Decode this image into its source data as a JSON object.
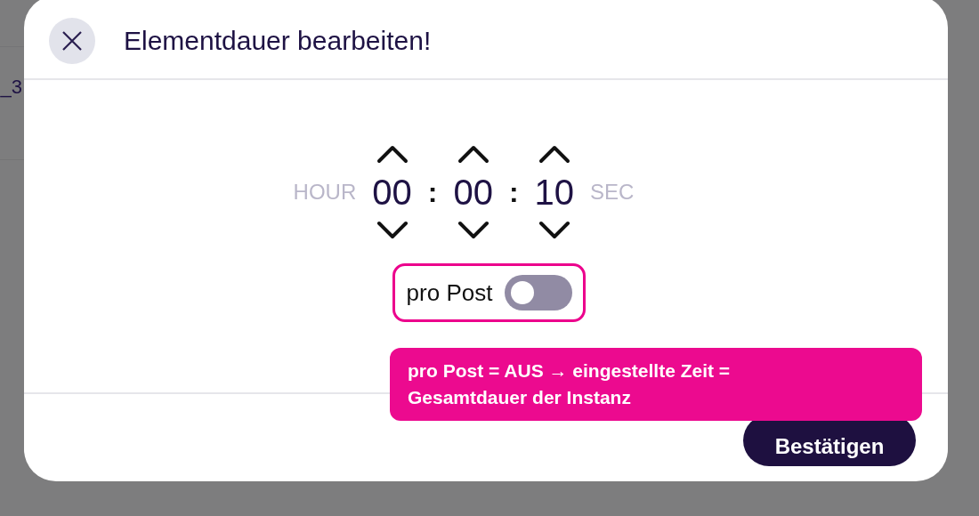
{
  "backdrop": {
    "text": "_3"
  },
  "dialog": {
    "title": "Elementdauer bearbeiten!",
    "time": {
      "leading_label": "HOUR",
      "trailing_label": "SEC",
      "separators": [
        ":",
        ":"
      ],
      "fields": [
        {
          "value": "00"
        },
        {
          "value": "00"
        },
        {
          "value": "10"
        }
      ]
    },
    "toggle": {
      "label": "pro Post",
      "on": false
    },
    "tooltip": "pro Post = AUS → eingestellte Zeit = Gesamtdauer der Instanz",
    "confirm_button": "Bestätigen"
  }
}
